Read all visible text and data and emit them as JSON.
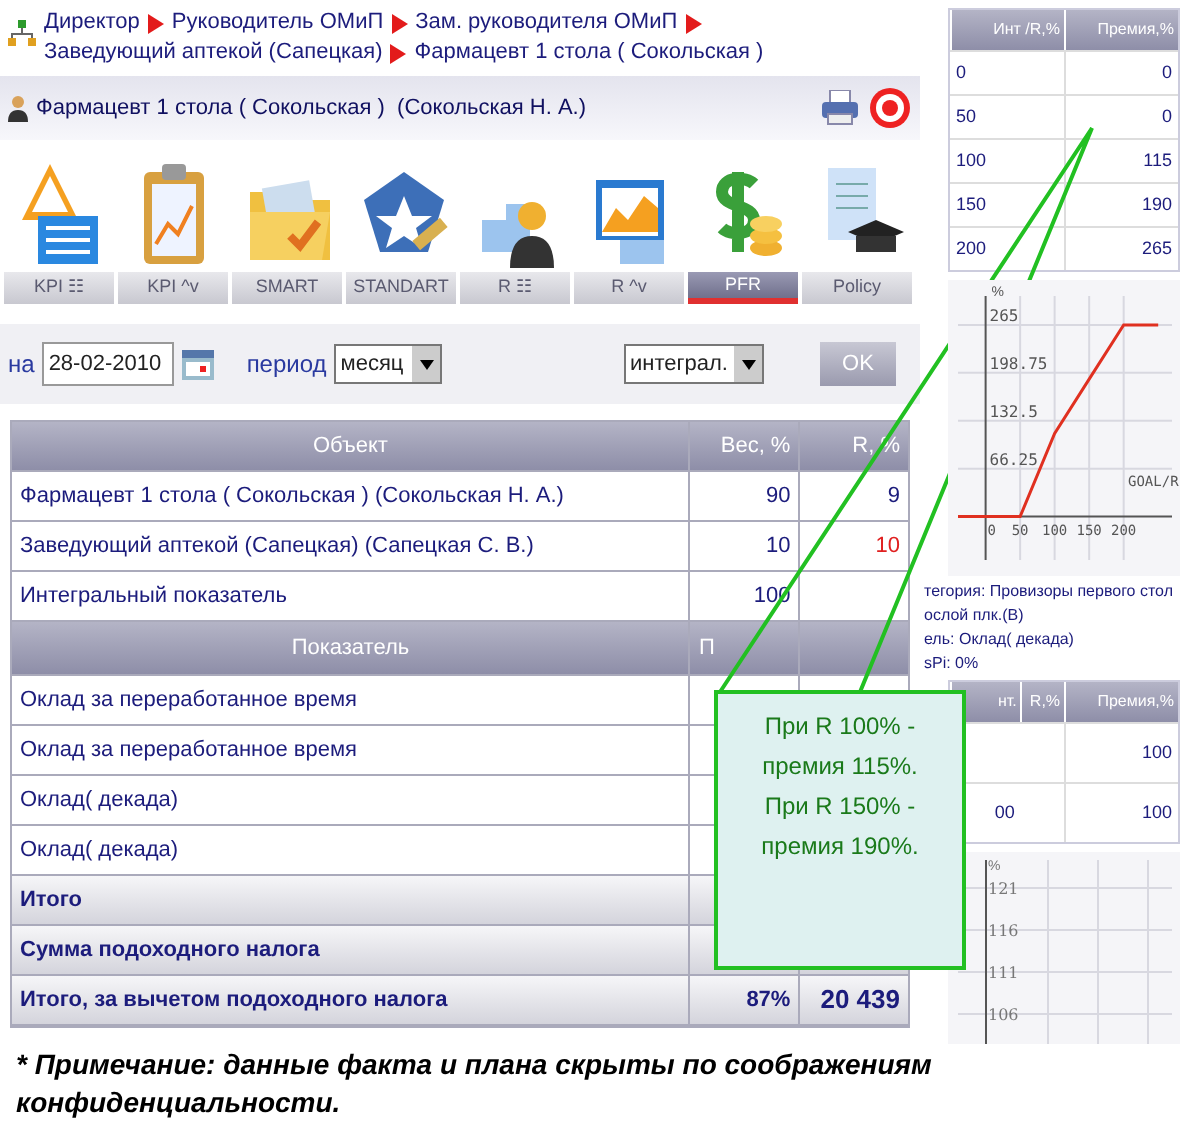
{
  "breadcrumb": [
    {
      "label": "Директор"
    },
    {
      "label": "Руководитель ОМиП"
    },
    {
      "label": "Зам. руководителя ОМиП"
    },
    {
      "label": "Заведующий аптекой (Сапецкая)"
    },
    {
      "label": "Фармацевт 1 стола ( Сокольская )"
    }
  ],
  "header": {
    "title": "Фармацевт 1 стола ( Сокольская )  (Сокольская Н. А.)"
  },
  "tabs": [
    {
      "label": "KPI ☷",
      "selected": false
    },
    {
      "label": "KPI ^v",
      "selected": false
    },
    {
      "label": "SMART",
      "selected": false
    },
    {
      "label": "STANDART",
      "selected": false
    },
    {
      "label": "R ☷",
      "selected": false
    },
    {
      "label": "R ^v",
      "selected": false
    },
    {
      "label": "PFR",
      "selected": true
    },
    {
      "label": "Policy",
      "selected": false
    }
  ],
  "filters": {
    "date_label": "на",
    "date": "28-02-2010",
    "period_label": "период",
    "period": "месяц",
    "mode": "интеграл.",
    "ok_button": "OK"
  },
  "objects_table": {
    "columns": [
      "Объект",
      "Вес, %",
      "R, %"
    ],
    "rows": [
      {
        "name": "Фармацевт 1 стола ( Сокольская ) (Сокольская Н. А.)",
        "weight": "90",
        "r": "9",
        "alert": false
      },
      {
        "name": "Заведующий аптекой (Сапецкая) (Сапецкая С. В.)",
        "weight": "10",
        "r": "10",
        "alert": true
      },
      {
        "name": "Интегральный показатель",
        "weight": "100"
      }
    ]
  },
  "indicators_table": {
    "columns": [
      "Показатель",
      "П"
    ],
    "rows": [
      {
        "name": "Оклад за переработанное время"
      },
      {
        "name": "Оклад за переработанное время"
      },
      {
        "name": "Оклад( декада)"
      },
      {
        "name": "Оклад( декада)"
      }
    ],
    "totals": [
      {
        "name": "Итого"
      },
      {
        "name": "Сумма подоходного налога"
      },
      {
        "name": "Итого, за вычетом подоходного налога",
        "column_2": "87%",
        "column_3": "20 439"
      }
    ]
  },
  "note": "* Примечание: данные факта и плана скрыты по соображениям конфиденциальности.",
  "bonus_table": {
    "columns": [
      "Инт /R,%",
      "Премия,%"
    ],
    "rows": [
      [
        "0",
        "0"
      ],
      [
        "50",
        "0"
      ],
      [
        "100",
        "115"
      ],
      [
        "150",
        "190"
      ],
      [
        "200",
        "265"
      ]
    ]
  },
  "bonus_chart": {
    "chart_data": {
      "type": "line",
      "xlabel": "GOAL/R",
      "ylabel": "%",
      "grid": true,
      "x": [
        -40,
        0,
        50,
        100,
        150,
        200,
        250
      ],
      "series": [
        {
          "color": "#e03020",
          "values": [
            0,
            0,
            0,
            115,
            190,
            265,
            265
          ]
        }
      ],
      "xlim": [
        -40,
        270
      ],
      "ylim": [
        -60,
        305
      ],
      "xticks": [
        0,
        50,
        100,
        150,
        200
      ],
      "yticks": [
        {
          "value": 66.25,
          "label": "66.25"
        },
        {
          "value": 132.5,
          "label": "132.5"
        },
        {
          "value": 198.75,
          "label": "198.75"
        },
        {
          "value": 265,
          "label": "265"
        }
      ]
    }
  },
  "details": [
    "тегория: Провизоры первого стол",
    "ослой плк.(В)",
    "ель: Оклад( декада)",
    "sPi: 0%"
  ],
  "bonus_table_2": {
    "columns": [
      "нт.",
      "R,%",
      "Премия,%"
    ],
    "rows": [
      {
        "column_3": "100"
      },
      {
        "column_1": "00",
        "column_3": "100"
      }
    ]
  },
  "chart_2": {
    "axis_title": "%",
    "axis_labels": [
      "121",
      "116",
      "111",
      "106"
    ]
  },
  "callout": {
    "text": [
      "При R 100% - премия 115%.",
      "При R 150% - премия 190%."
    ]
  }
}
